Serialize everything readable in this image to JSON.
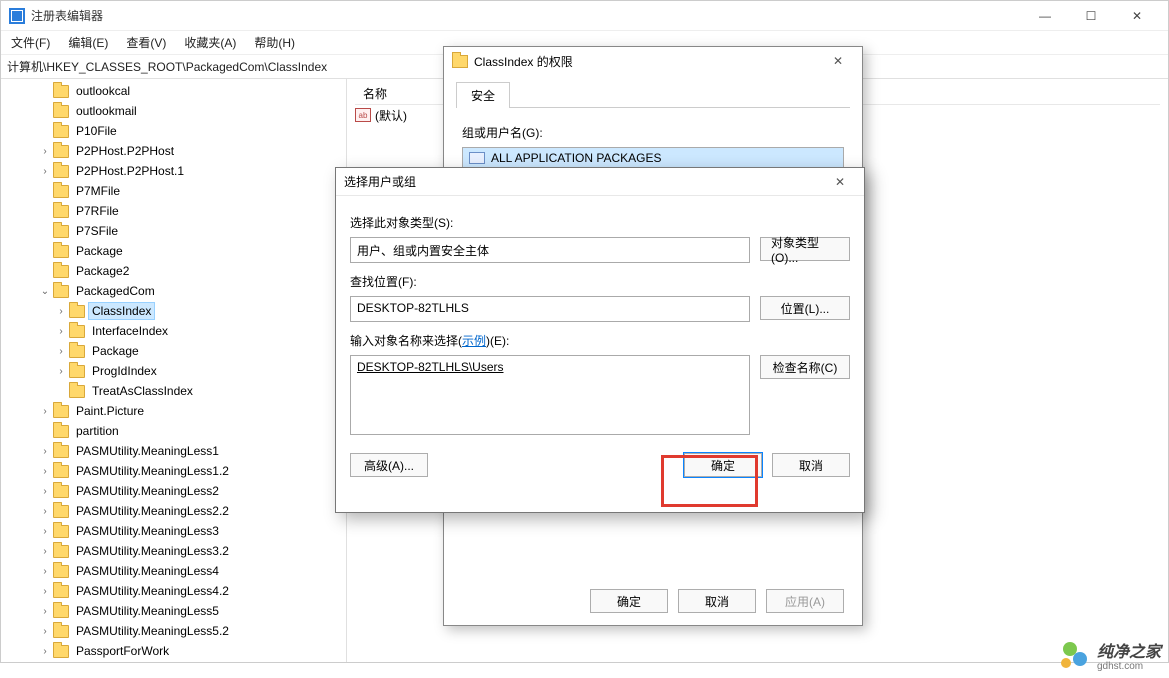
{
  "app": {
    "title": "注册表编辑器",
    "minimize": "—",
    "maximize": "☐",
    "close": "✕"
  },
  "menu": {
    "file": "文件(F)",
    "edit": "编辑(E)",
    "view": "查看(V)",
    "favorites": "收藏夹(A)",
    "help": "帮助(H)"
  },
  "address": "计算机\\HKEY_CLASSES_ROOT\\PackagedCom\\ClassIndex",
  "tree": [
    {
      "name": "outlookcal",
      "indent": 2,
      "exp": ""
    },
    {
      "name": "outlookmail",
      "indent": 2,
      "exp": ""
    },
    {
      "name": "P10File",
      "indent": 2,
      "exp": ""
    },
    {
      "name": "P2PHost.P2PHost",
      "indent": 2,
      "exp": ">"
    },
    {
      "name": "P2PHost.P2PHost.1",
      "indent": 2,
      "exp": ">"
    },
    {
      "name": "P7MFile",
      "indent": 2,
      "exp": ""
    },
    {
      "name": "P7RFile",
      "indent": 2,
      "exp": ""
    },
    {
      "name": "P7SFile",
      "indent": 2,
      "exp": ""
    },
    {
      "name": "Package",
      "indent": 2,
      "exp": ""
    },
    {
      "name": "Package2",
      "indent": 2,
      "exp": ""
    },
    {
      "name": "PackagedCom",
      "indent": 2,
      "exp": "v"
    },
    {
      "name": "ClassIndex",
      "indent": 3,
      "exp": ">",
      "selected": true
    },
    {
      "name": "InterfaceIndex",
      "indent": 3,
      "exp": ">"
    },
    {
      "name": "Package",
      "indent": 3,
      "exp": ">"
    },
    {
      "name": "ProgIdIndex",
      "indent": 3,
      "exp": ">"
    },
    {
      "name": "TreatAsClassIndex",
      "indent": 3,
      "exp": ""
    },
    {
      "name": "Paint.Picture",
      "indent": 2,
      "exp": ">"
    },
    {
      "name": "partition",
      "indent": 2,
      "exp": ""
    },
    {
      "name": "PASMUtility.MeaningLess1",
      "indent": 2,
      "exp": ">"
    },
    {
      "name": "PASMUtility.MeaningLess1.2",
      "indent": 2,
      "exp": ">"
    },
    {
      "name": "PASMUtility.MeaningLess2",
      "indent": 2,
      "exp": ">"
    },
    {
      "name": "PASMUtility.MeaningLess2.2",
      "indent": 2,
      "exp": ">"
    },
    {
      "name": "PASMUtility.MeaningLess3",
      "indent": 2,
      "exp": ">"
    },
    {
      "name": "PASMUtility.MeaningLess3.2",
      "indent": 2,
      "exp": ">"
    },
    {
      "name": "PASMUtility.MeaningLess4",
      "indent": 2,
      "exp": ">"
    },
    {
      "name": "PASMUtility.MeaningLess4.2",
      "indent": 2,
      "exp": ">"
    },
    {
      "name": "PASMUtility.MeaningLess5",
      "indent": 2,
      "exp": ">"
    },
    {
      "name": "PASMUtility.MeaningLess5.2",
      "indent": 2,
      "exp": ">"
    },
    {
      "name": "PassportForWork",
      "indent": 2,
      "exp": ">"
    }
  ],
  "values": {
    "col_name": "名称",
    "default_name": "(默认)",
    "ab_icon": "ab"
  },
  "perm_dialog": {
    "title": "ClassIndex 的权限",
    "close": "✕",
    "tab_security": "安全",
    "groups_label": "组或用户名(G):",
    "group_item": "ALL APPLICATION PACKAGES",
    "ok": "确定",
    "cancel": "取消",
    "apply": "应用(A)"
  },
  "select_dialog": {
    "title": "选择用户或组",
    "close": "✕",
    "object_type_label": "选择此对象类型(S):",
    "object_type_value": "用户、组或内置安全主体",
    "object_type_btn": "对象类型(O)...",
    "location_label": "查找位置(F):",
    "location_value": "DESKTOP-82TLHLS",
    "location_btn": "位置(L)...",
    "enter_label_pre": "输入对象名称来选择(",
    "enter_label_link": "示例",
    "enter_label_post": ")(E):",
    "enter_value": "DESKTOP-82TLHLS\\Users",
    "check_btn": "检查名称(C)",
    "advanced_btn": "高级(A)...",
    "ok": "确定",
    "cancel": "取消"
  },
  "watermark": {
    "line1": "纯净之家",
    "line2": "gdhst.com"
  }
}
